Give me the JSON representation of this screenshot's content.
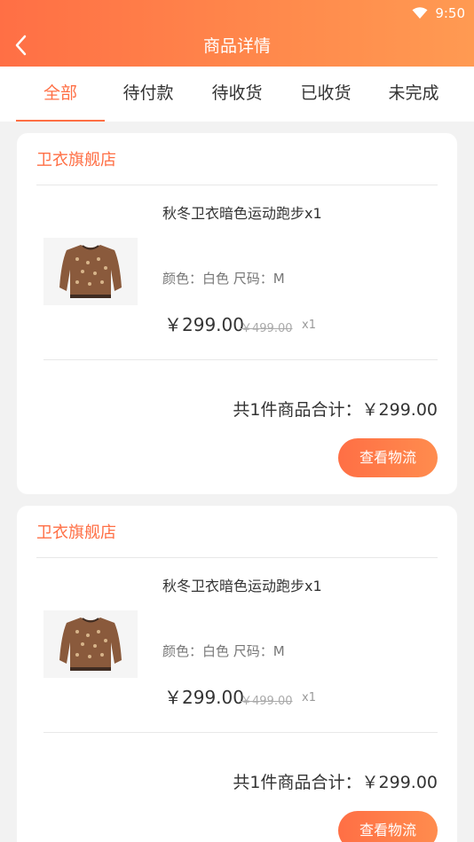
{
  "status": {
    "time": "9:50"
  },
  "header": {
    "title": "商品详情"
  },
  "tabs": [
    {
      "label": "全部",
      "active": true
    },
    {
      "label": "待付款"
    },
    {
      "label": "待收货"
    },
    {
      "label": "已收货"
    },
    {
      "label": "未完成"
    }
  ],
  "orders": [
    {
      "store": "卫衣旗舰店",
      "product_name": "秋冬卫衣暗色运动跑步x1",
      "attrs": "颜色：白色 尺码：M",
      "price": "￥299.00",
      "original_price": "￥499.00",
      "qty": "x1",
      "summary": "共1件商品合计：￥299.00",
      "action": "查看物流"
    },
    {
      "store": "卫衣旗舰店",
      "product_name": "秋冬卫衣暗色运动跑步x1",
      "attrs": "颜色：白色 尺码：M",
      "price": "￥299.00",
      "original_price": "￥499.00",
      "qty": "x1",
      "summary": "共1件商品合计：￥299.00",
      "action": "查看物流"
    }
  ],
  "colors": {
    "accent": "#ff6f45",
    "header_start": "#ff6f45",
    "header_end": "#ff9a52",
    "background": "#f2f2f2"
  },
  "icons": {
    "back": "chevron-left-icon",
    "wifi": "wifi-icon",
    "product": "sweater-icon"
  }
}
